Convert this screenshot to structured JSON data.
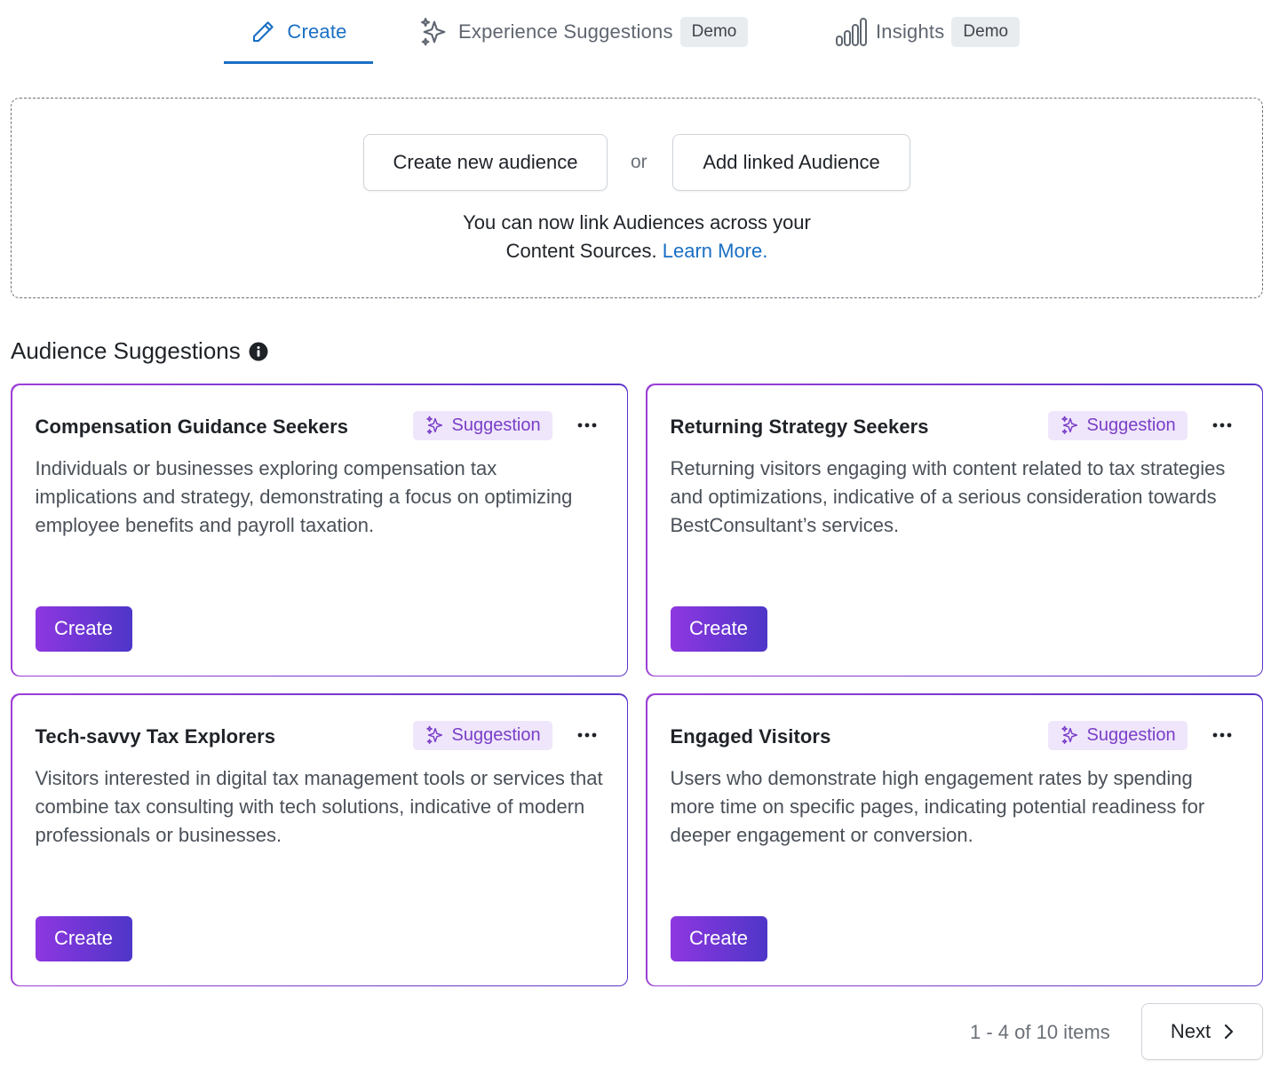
{
  "tabs": [
    {
      "label": "Create",
      "icon": "pencil-icon",
      "active": true
    },
    {
      "label": "Experience Suggestions",
      "icon": "sparkle-icon",
      "badge": "Demo"
    },
    {
      "label": "Insights",
      "icon": "bar-chart-icon",
      "badge": "Demo"
    }
  ],
  "panel": {
    "create_new_label": "Create new audience",
    "or_label": "or",
    "add_linked_label": "Add linked Audience",
    "text_line1": "You can now link Audiences across your",
    "text_line2": "Content Sources.",
    "learn_more": "Learn More."
  },
  "section": {
    "title": "Audience Suggestions"
  },
  "cards": [
    {
      "title": "Compensation Guidance Seekers",
      "badge": "Suggestion",
      "description": "Individuals or businesses exploring compensation tax implications and strategy, demonstrating a focus on optimizing employee benefits and payroll taxation.",
      "button": "Create"
    },
    {
      "title": "Returning Strategy Seekers",
      "badge": "Suggestion",
      "description": "Returning visitors engaging with content related to tax strategies and optimizations, indicative of a serious consideration towards BestConsultant’s services.",
      "button": "Create"
    },
    {
      "title": "Tech-savvy Tax Explorers",
      "badge": "Suggestion",
      "description": "Visitors interested in digital tax management tools or services that combine tax consulting with tech solutions, indicative of modern professionals or businesses.",
      "button": "Create"
    },
    {
      "title": "Engaged Visitors",
      "badge": "Suggestion",
      "description": "Users who demonstrate high engagement rates by spending more time on specific pages, indicating potential readiness for deeper engagement or conversion.",
      "button": "Create"
    }
  ],
  "pagination": {
    "info": "1 - 4 of 10 items",
    "next_label": "Next"
  },
  "colors": {
    "accent_blue": "#1a6fc4",
    "purple_start": "#8e37e0",
    "purple_end": "#4e36c8",
    "badge_bg": "#efe6fb"
  }
}
